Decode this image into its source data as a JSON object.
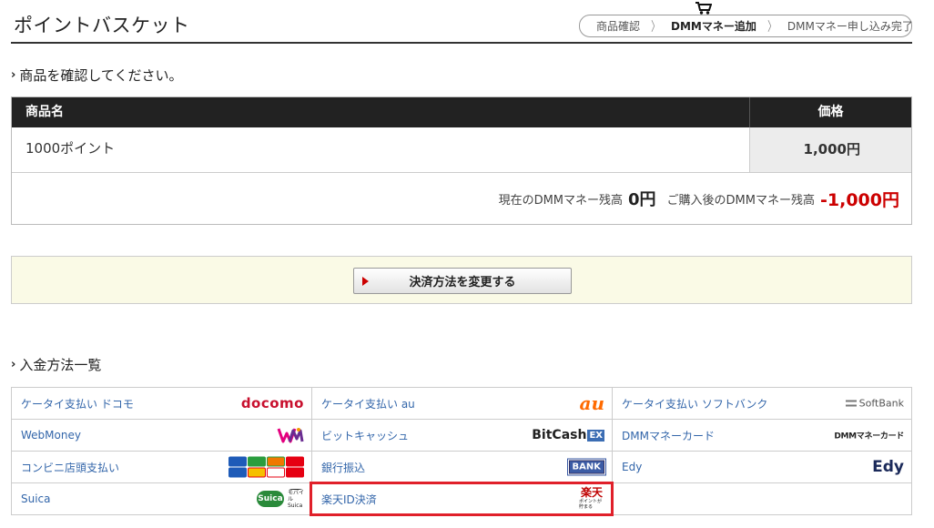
{
  "header": {
    "title": "ポイントバスケット",
    "cart_icon": "cart-icon",
    "steps": [
      "商品確認",
      "DMMマネー追加",
      "DMMマネー申し込み完了"
    ],
    "active_step": 1
  },
  "confirm": {
    "heading": "商品を確認してください。",
    "columns": {
      "name": "商品名",
      "price": "価格"
    },
    "item": {
      "name": "1000ポイント",
      "price": "1,000円"
    },
    "balance_label": "現在のDMMマネー残高",
    "balance_value": "0円",
    "after_label": "ご購入後のDMMマネー残高",
    "after_value": "-1,000円"
  },
  "change": {
    "button_label": "決済方法を変更する"
  },
  "methods": {
    "heading": "入金方法一覧",
    "items": [
      {
        "label": "ケータイ支払い ドコモ",
        "logo": "docomo"
      },
      {
        "label": "ケータイ支払い au",
        "logo": "au"
      },
      {
        "label": "ケータイ支払い ソフトバンク",
        "logo": "SoftBank"
      },
      {
        "label": "WebMoney",
        "logo": "WM"
      },
      {
        "label": "ビットキャッシュ",
        "logo": "BitCash",
        "logo_sub": "EX"
      },
      {
        "label": "DMMマネーカード",
        "logo": "DMMマネーカード"
      },
      {
        "label": "コンビニ店頭支払い",
        "logo": "convenience-stores-logo"
      },
      {
        "label": "銀行振込",
        "logo": "BANK"
      },
      {
        "label": "Edy",
        "logo": "Edy"
      },
      {
        "label": "Suica",
        "logo": "Suica",
        "logo_sub": "モバイルSuica"
      },
      {
        "label": "楽天ID決済",
        "logo": "楽天",
        "logo_sub": "ポイントが貯まる",
        "highlighted": true
      }
    ]
  },
  "colors": {
    "negative": "#cc0000",
    "link": "#3366aa",
    "highlight": "#e0202a",
    "table_head": "#222222",
    "notice_bg": "#fafae6"
  }
}
